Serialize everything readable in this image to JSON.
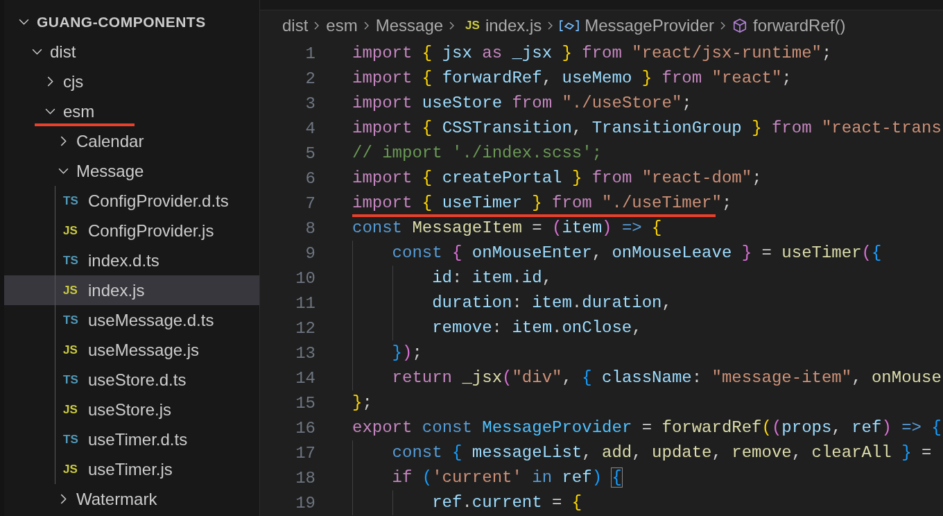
{
  "explorer": {
    "title": "GUANG-COMPONENTS",
    "expanded": true,
    "children": [
      {
        "label": "dist",
        "kind": "folder",
        "expanded": true,
        "selected": false,
        "annotated": false,
        "children": [
          {
            "label": "cjs",
            "kind": "folder",
            "expanded": false,
            "selected": false,
            "annotated": false
          },
          {
            "label": "esm",
            "kind": "folder",
            "expanded": true,
            "selected": false,
            "annotated": true,
            "children": [
              {
                "label": "Calendar",
                "kind": "folder",
                "expanded": false,
                "selected": false,
                "annotated": false
              },
              {
                "label": "Message",
                "kind": "folder",
                "expanded": true,
                "selected": false,
                "annotated": false,
                "children": [
                  {
                    "label": "ConfigProvider.d.ts",
                    "kind": "ts",
                    "badge": "TS",
                    "selected": false,
                    "annotated": false
                  },
                  {
                    "label": "ConfigProvider.js",
                    "kind": "js",
                    "badge": "JS",
                    "selected": false,
                    "annotated": false
                  },
                  {
                    "label": "index.d.ts",
                    "kind": "ts",
                    "badge": "TS",
                    "selected": false,
                    "annotated": false
                  },
                  {
                    "label": "index.js",
                    "kind": "js",
                    "badge": "JS",
                    "selected": true,
                    "annotated": false
                  },
                  {
                    "label": "useMessage.d.ts",
                    "kind": "ts",
                    "badge": "TS",
                    "selected": false,
                    "annotated": false
                  },
                  {
                    "label": "useMessage.js",
                    "kind": "js",
                    "badge": "JS",
                    "selected": false,
                    "annotated": false
                  },
                  {
                    "label": "useStore.d.ts",
                    "kind": "ts",
                    "badge": "TS",
                    "selected": false,
                    "annotated": false
                  },
                  {
                    "label": "useStore.js",
                    "kind": "js",
                    "badge": "JS",
                    "selected": false,
                    "annotated": false
                  },
                  {
                    "label": "useTimer.d.ts",
                    "kind": "ts",
                    "badge": "TS",
                    "selected": false,
                    "annotated": false
                  },
                  {
                    "label": "useTimer.js",
                    "kind": "js",
                    "badge": "JS",
                    "selected": false,
                    "annotated": false
                  }
                ]
              },
              {
                "label": "Watermark",
                "kind": "folder",
                "expanded": false,
                "selected": false,
                "annotated": false
              }
            ]
          }
        ]
      }
    ]
  },
  "breadcrumb": [
    {
      "label": "dist",
      "kind": "folder"
    },
    {
      "label": "esm",
      "kind": "folder"
    },
    {
      "label": "Message",
      "kind": "folder"
    },
    {
      "label": "index.js",
      "kind": "js",
      "badge": "JS"
    },
    {
      "label": "MessageProvider",
      "kind": "variable"
    },
    {
      "label": "forwardRef()",
      "kind": "function"
    }
  ],
  "code": [
    {
      "number": "1",
      "annotated": false,
      "tokens": [
        {
          "kind": "keyword",
          "text": "import"
        },
        {
          "kind": "brace1",
          "text": " {"
        },
        {
          "kind": "variable",
          "text": " jsx "
        },
        {
          "kind": "keyword",
          "text": "as"
        },
        {
          "kind": "variable",
          "text": " _jsx "
        },
        {
          "kind": "brace1",
          "text": "}"
        },
        {
          "kind": "keyword",
          "text": " from"
        },
        {
          "kind": "string",
          "text": " \"react/jsx-runtime\""
        },
        {
          "kind": "plain",
          "text": ";"
        }
      ]
    },
    {
      "number": "2",
      "annotated": false,
      "tokens": [
        {
          "kind": "keyword",
          "text": "import"
        },
        {
          "kind": "brace1",
          "text": " {"
        },
        {
          "kind": "variable",
          "text": " forwardRef"
        },
        {
          "kind": "plain",
          "text": ","
        },
        {
          "kind": "variable",
          "text": " useMemo "
        },
        {
          "kind": "brace1",
          "text": "}"
        },
        {
          "kind": "keyword",
          "text": " from"
        },
        {
          "kind": "string",
          "text": " \"react\""
        },
        {
          "kind": "plain",
          "text": ";"
        }
      ]
    },
    {
      "number": "3",
      "annotated": false,
      "tokens": [
        {
          "kind": "keyword",
          "text": "import"
        },
        {
          "kind": "variable",
          "text": " useStore "
        },
        {
          "kind": "keyword",
          "text": "from"
        },
        {
          "kind": "string",
          "text": " \"./useStore\""
        },
        {
          "kind": "plain",
          "text": ";"
        }
      ]
    },
    {
      "number": "4",
      "annotated": false,
      "tokens": [
        {
          "kind": "keyword",
          "text": "import"
        },
        {
          "kind": "brace1",
          "text": " {"
        },
        {
          "kind": "variable",
          "text": " CSSTransition"
        },
        {
          "kind": "plain",
          "text": ","
        },
        {
          "kind": "variable",
          "text": " TransitionGroup "
        },
        {
          "kind": "brace1",
          "text": "}"
        },
        {
          "kind": "keyword",
          "text": " from"
        },
        {
          "kind": "string",
          "text": " \"react-trans"
        }
      ]
    },
    {
      "number": "5",
      "annotated": false,
      "tokens": [
        {
          "kind": "comment",
          "text": "// import './index.scss';"
        }
      ]
    },
    {
      "number": "6",
      "annotated": false,
      "tokens": [
        {
          "kind": "keyword",
          "text": "import"
        },
        {
          "kind": "brace1",
          "text": " {"
        },
        {
          "kind": "variable",
          "text": " createPortal "
        },
        {
          "kind": "brace1",
          "text": "}"
        },
        {
          "kind": "keyword",
          "text": " from"
        },
        {
          "kind": "string",
          "text": " \"react-dom\""
        },
        {
          "kind": "plain",
          "text": ";"
        }
      ]
    },
    {
      "number": "7",
      "annotated": true,
      "tokens": [
        {
          "kind": "keyword",
          "text": "import"
        },
        {
          "kind": "brace1",
          "text": " {"
        },
        {
          "kind": "variable",
          "text": " useTimer "
        },
        {
          "kind": "brace1",
          "text": "}"
        },
        {
          "kind": "keyword",
          "text": " from"
        },
        {
          "kind": "string",
          "text": " \"./useTimer\""
        },
        {
          "kind": "plain",
          "text": ";"
        }
      ]
    },
    {
      "number": "8",
      "annotated": false,
      "tokens": [
        {
          "kind": "storage",
          "text": "const"
        },
        {
          "kind": "function",
          "text": " MessageItem"
        },
        {
          "kind": "plain",
          "text": " ="
        },
        {
          "kind": "brace2",
          "text": " ("
        },
        {
          "kind": "variable",
          "text": "item"
        },
        {
          "kind": "brace2",
          "text": ")"
        },
        {
          "kind": "storage",
          "text": " =>"
        },
        {
          "kind": "brace1",
          "text": " {"
        }
      ]
    },
    {
      "number": "9",
      "annotated": false,
      "tokens": [
        {
          "kind": "storage",
          "text": "    const"
        },
        {
          "kind": "brace2",
          "text": " {"
        },
        {
          "kind": "variable",
          "text": " onMouseEnter"
        },
        {
          "kind": "plain",
          "text": ","
        },
        {
          "kind": "variable",
          "text": " onMouseLeave "
        },
        {
          "kind": "brace2",
          "text": "}"
        },
        {
          "kind": "plain",
          "text": " ="
        },
        {
          "kind": "function",
          "text": " useTimer"
        },
        {
          "kind": "brace2",
          "text": "("
        },
        {
          "kind": "brace3",
          "text": "{"
        }
      ]
    },
    {
      "number": "10",
      "annotated": false,
      "tokens": [
        {
          "kind": "variable",
          "text": "        id"
        },
        {
          "kind": "plain",
          "text": ":"
        },
        {
          "kind": "variable",
          "text": " item"
        },
        {
          "kind": "plain",
          "text": "."
        },
        {
          "kind": "variable",
          "text": "id"
        },
        {
          "kind": "plain",
          "text": ","
        }
      ]
    },
    {
      "number": "11",
      "annotated": false,
      "tokens": [
        {
          "kind": "variable",
          "text": "        duration"
        },
        {
          "kind": "plain",
          "text": ":"
        },
        {
          "kind": "variable",
          "text": " item"
        },
        {
          "kind": "plain",
          "text": "."
        },
        {
          "kind": "variable",
          "text": "duration"
        },
        {
          "kind": "plain",
          "text": ","
        }
      ]
    },
    {
      "number": "12",
      "annotated": false,
      "tokens": [
        {
          "kind": "variable",
          "text": "        remove"
        },
        {
          "kind": "plain",
          "text": ":"
        },
        {
          "kind": "variable",
          "text": " item"
        },
        {
          "kind": "plain",
          "text": "."
        },
        {
          "kind": "variable",
          "text": "onClose"
        },
        {
          "kind": "plain",
          "text": ","
        }
      ]
    },
    {
      "number": "13",
      "annotated": false,
      "tokens": [
        {
          "kind": "brace3",
          "text": "    }"
        },
        {
          "kind": "brace2",
          "text": ")"
        },
        {
          "kind": "plain",
          "text": ";"
        }
      ]
    },
    {
      "number": "14",
      "annotated": false,
      "tokens": [
        {
          "kind": "keyword",
          "text": "    return"
        },
        {
          "kind": "function",
          "text": " _jsx"
        },
        {
          "kind": "brace2",
          "text": "("
        },
        {
          "kind": "string",
          "text": "\"div\""
        },
        {
          "kind": "plain",
          "text": ","
        },
        {
          "kind": "brace3",
          "text": " {"
        },
        {
          "kind": "variable",
          "text": " className"
        },
        {
          "kind": "plain",
          "text": ":"
        },
        {
          "kind": "string",
          "text": " \"message-item\""
        },
        {
          "kind": "plain",
          "text": ","
        },
        {
          "kind": "function",
          "text": " onMouse"
        }
      ]
    },
    {
      "number": "15",
      "annotated": false,
      "tokens": [
        {
          "kind": "brace1",
          "text": "}"
        },
        {
          "kind": "plain",
          "text": ";"
        }
      ]
    },
    {
      "number": "16",
      "annotated": false,
      "tokens": [
        {
          "kind": "keyword",
          "text": "export"
        },
        {
          "kind": "storage",
          "text": " const"
        },
        {
          "kind": "constant",
          "text": " MessageProvider"
        },
        {
          "kind": "plain",
          "text": " ="
        },
        {
          "kind": "function",
          "text": " forwardRef"
        },
        {
          "kind": "brace1",
          "text": "("
        },
        {
          "kind": "brace2",
          "text": "("
        },
        {
          "kind": "variable",
          "text": "props"
        },
        {
          "kind": "plain",
          "text": ","
        },
        {
          "kind": "variable",
          "text": " ref"
        },
        {
          "kind": "brace2",
          "text": ")"
        },
        {
          "kind": "storage",
          "text": " =>"
        },
        {
          "kind": "brace3",
          "text": " {"
        }
      ]
    },
    {
      "number": "17",
      "annotated": false,
      "tokens": [
        {
          "kind": "storage",
          "text": "    const"
        },
        {
          "kind": "brace3",
          "text": " {"
        },
        {
          "kind": "variable",
          "text": " messageList"
        },
        {
          "kind": "plain",
          "text": ","
        },
        {
          "kind": "function",
          "text": " add"
        },
        {
          "kind": "plain",
          "text": ","
        },
        {
          "kind": "function",
          "text": " update"
        },
        {
          "kind": "plain",
          "text": ","
        },
        {
          "kind": "function",
          "text": " remove"
        },
        {
          "kind": "plain",
          "text": ","
        },
        {
          "kind": "function",
          "text": " clearAll "
        },
        {
          "kind": "brace3",
          "text": "}"
        },
        {
          "kind": "plain",
          "text": " ="
        }
      ]
    },
    {
      "number": "18",
      "annotated": false,
      "tokens": [
        {
          "kind": "keyword",
          "text": "    if"
        },
        {
          "kind": "brace3",
          "text": " ("
        },
        {
          "kind": "string",
          "text": "'current'"
        },
        {
          "kind": "storage",
          "text": " in"
        },
        {
          "kind": "variable",
          "text": " ref"
        },
        {
          "kind": "brace3",
          "text": ") "
        },
        {
          "kind": "brace-match",
          "text": "{"
        }
      ]
    },
    {
      "number": "19",
      "annotated": false,
      "tokens": [
        {
          "kind": "variable",
          "text": "        ref"
        },
        {
          "kind": "plain",
          "text": "."
        },
        {
          "kind": "variable",
          "text": "current"
        },
        {
          "kind": "plain",
          "text": " ="
        },
        {
          "kind": "brace1",
          "text": " {"
        }
      ]
    }
  ]
}
